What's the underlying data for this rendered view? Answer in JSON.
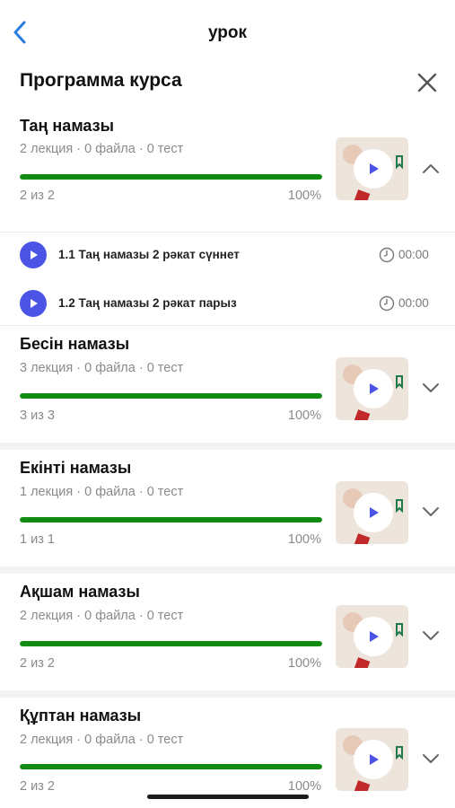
{
  "nav": {
    "title": "урок",
    "back_icon": "chevron-left-icon"
  },
  "sheet": {
    "title": "Программа курса",
    "close_icon": "close-icon"
  },
  "colors": {
    "accent": "#128b12",
    "lecture_play": "#4c54e6",
    "back": "#2a7de1"
  },
  "sections": [
    {
      "title": "Таң намазы",
      "meta": "2 лекция · 0 файла · 0 тест",
      "progress_count": "2 из 2",
      "progress_percent": "100%",
      "progress": 1.0,
      "expanded": true
    },
    {
      "title": "Бесін намазы",
      "meta": "3 лекция · 0 файла · 0 тест",
      "progress_count": "3 из 3",
      "progress_percent": "100%",
      "progress": 1.0,
      "expanded": false
    },
    {
      "title": "Екінті намазы",
      "meta": "1 лекция · 0 файла · 0 тест",
      "progress_count": "1 из 1",
      "progress_percent": "100%",
      "progress": 1.0,
      "expanded": false
    },
    {
      "title": "Ақшам намазы",
      "meta": "2 лекция · 0 файла · 0 тест",
      "progress_count": "2 из 2",
      "progress_percent": "100%",
      "progress": 1.0,
      "expanded": false
    },
    {
      "title": "Құптан намазы",
      "meta": "2 лекция · 0 файла · 0 тест",
      "progress_count": "2 из 2",
      "progress_percent": "100%",
      "progress": 1.0,
      "expanded": false
    }
  ],
  "lectures": [
    {
      "title": "1.1 Таң намазы 2 рәкат сүннет",
      "duration": "00:00"
    },
    {
      "title": "1.2 Таң намазы 2 рәкат парыз",
      "duration": "00:00"
    }
  ]
}
